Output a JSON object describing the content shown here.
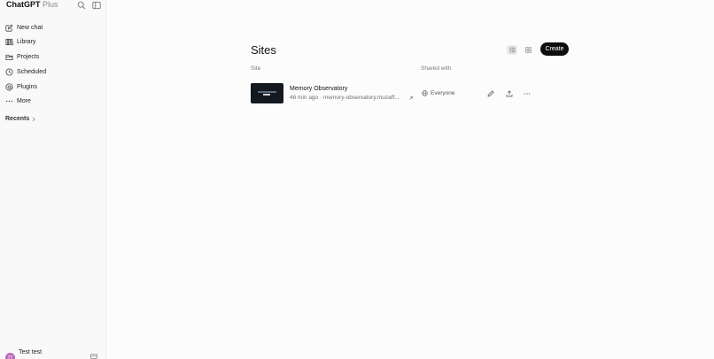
{
  "sidebar": {
    "brand_name": "ChatGPT",
    "brand_tier": "Plus",
    "search_icon": "search-icon",
    "toggle_icon": "sidebar-toggle-icon",
    "items": [
      {
        "label": "New chat",
        "icon": "edit-icon"
      },
      {
        "label": "Library",
        "icon": "library-icon"
      },
      {
        "label": "Projects",
        "icon": "folder-icon"
      },
      {
        "label": "Scheduled",
        "icon": "clock-icon"
      },
      {
        "label": "Plugins",
        "icon": "at-icon"
      },
      {
        "label": "More",
        "icon": "more-icon"
      }
    ],
    "recents_label": "Recents",
    "user": {
      "name": "Test test",
      "initials": "TT"
    }
  },
  "main": {
    "title": "Sites",
    "create_label": "Create",
    "columns": {
      "site": "Site",
      "shared": "Shared with"
    },
    "sites": [
      {
        "name": "Memory Observatory",
        "age": "46 min ago",
        "separator": "·",
        "url": "memory-observatory.muzaff...",
        "shared_with": "Everyone"
      }
    ]
  },
  "colors": {
    "accent": "#0d0d0d",
    "avatar": "#b76bbf"
  }
}
